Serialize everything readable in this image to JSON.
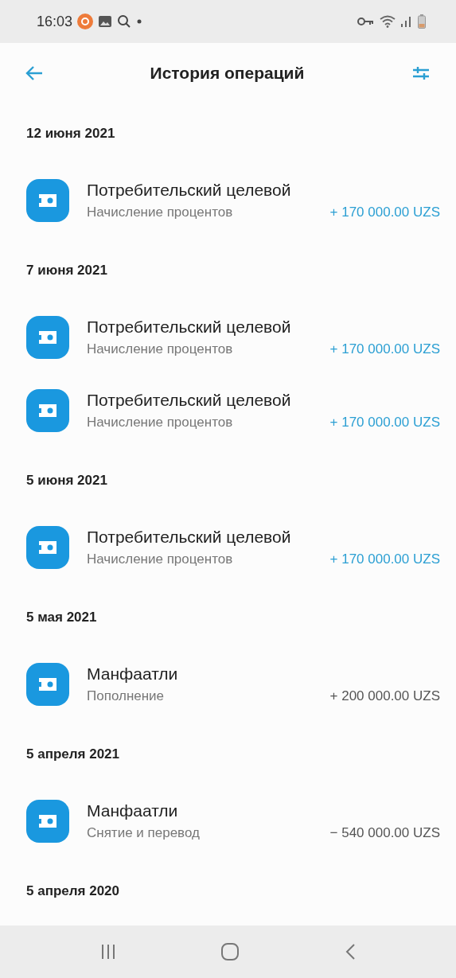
{
  "status_bar": {
    "time": "16:03"
  },
  "header": {
    "title": "История операций"
  },
  "groups": [
    {
      "date": "12 июня 2021",
      "items": [
        {
          "name": "Потребительский целевой",
          "operation": "Начисление процентов",
          "amount": "+ 170 000.00 UZS",
          "color": "#2b9fd3"
        }
      ]
    },
    {
      "date": "7 июня 2021",
      "items": [
        {
          "name": "Потребительский целевой",
          "operation": "Начисление процентов",
          "amount": "+ 170 000.00 UZS",
          "color": "#2b9fd3"
        },
        {
          "name": "Потребительский целевой",
          "operation": "Начисление процентов",
          "amount": "+ 170 000.00 UZS",
          "color": "#2b9fd3"
        }
      ]
    },
    {
      "date": "5 июня 2021",
      "items": [
        {
          "name": "Потребительский целевой",
          "operation": "Начисление процентов",
          "amount": "+ 170 000.00 UZS",
          "color": "#2b9fd3"
        }
      ]
    },
    {
      "date": "5 мая 2021",
      "items": [
        {
          "name": "Манфаатли",
          "operation": "Пополнение",
          "amount": "+ 200 000.00 UZS",
          "color": "#555555"
        }
      ]
    },
    {
      "date": "5 апреля 2021",
      "items": [
        {
          "name": "Манфаатли",
          "operation": "Снятие и перевод",
          "amount": "− 540 000.00 UZS",
          "color": "#555555"
        }
      ]
    },
    {
      "date": "5 апреля 2020"
    }
  ]
}
